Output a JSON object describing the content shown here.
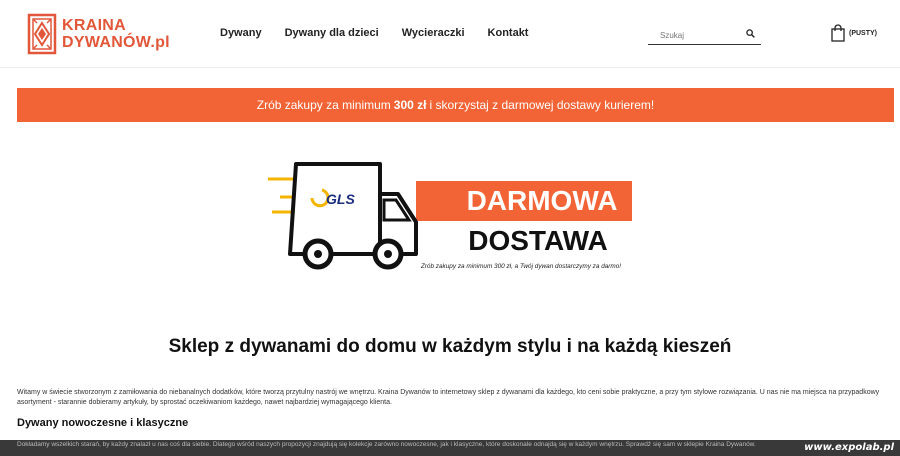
{
  "brand": {
    "line1": "KRAINA",
    "line2": "DYWANÓW.pl",
    "color": "#e2573a"
  },
  "nav": {
    "items": [
      "Dywany",
      "Dywany dla dzieci",
      "Wycieraczki",
      "Kontakt"
    ]
  },
  "search": {
    "placeholder": "Szukaj"
  },
  "cart": {
    "label": "(PUSTY)"
  },
  "banner": {
    "before": "Zrób zakupy za minimum",
    "amount": "300 zł",
    "after": "i skorzystaj z darmowej dostawy kurierem!",
    "color": "#f26436"
  },
  "promo": {
    "gls": "GLS",
    "line1": "DARMOWA",
    "line2": "DOSTAWA",
    "caption": "Zrób zakupy za minimum 300 zł, a Twój dywan dostarczymy za darmo!"
  },
  "content": {
    "title": "Sklep z dywanami do domu w każdym stylu i na każdą kieszeń",
    "intro": "Witamy w świecie stworzonym z zamiłowania do niebanalnych dodatków, które tworzą przytulny nastrój we wnętrzu. Kraina Dywanów to internetowy sklep z dywanami dla każdego, kto ceni sobie praktyczne, a przy tym stylowe rozwiązania. U nas nie ma miejsca na przypadkowy asortyment - starannie dobieramy artykuły, by sprostać oczekiwaniom każdego, nawet najbardziej wymagającego klienta.",
    "subtitle": "Dywany nowoczesne i klasyczne",
    "para2": "Dokładamy wszelkich starań, by każdy znalazł u nas coś dla siebie. Dlatego wśród naszych propozycji znajdują się kolekcje zarówno nowoczesne, jak i klasyczne, które doskonale odnajdą się w każdym wnętrzu. Sprawdź się sam w sklepie Kraina Dywanów."
  },
  "watermark": "www.expolab.pl"
}
